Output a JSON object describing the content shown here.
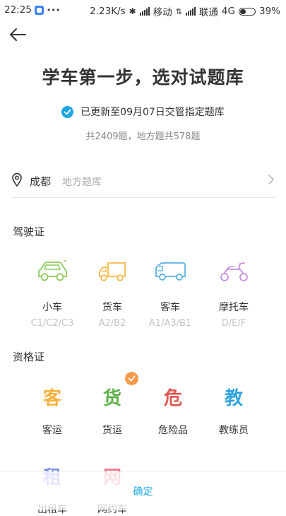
{
  "status_bar": {
    "time": "22:25",
    "dots": "•••",
    "speed": "2.23K/s",
    "carrier1": "移动",
    "carrier2": "联通",
    "network": "4G",
    "battery": "39%"
  },
  "header": {
    "title": "学车第一步，选对试题库",
    "updated": "已更新至09月07日交管指定题库",
    "counts": "共2409题，地方题共578题"
  },
  "location": {
    "city": "成都",
    "placeholder": "地方题库"
  },
  "license": {
    "heading": "驾驶证",
    "items": [
      {
        "label": "小车",
        "sub": "C1/C2/C3",
        "icon": "car-icon",
        "color": "#8ccc5a"
      },
      {
        "label": "货车",
        "sub": "A2/B2",
        "icon": "truck-icon",
        "color": "#f5b94a"
      },
      {
        "label": "客车",
        "sub": "A1/A3/B1",
        "icon": "bus-icon",
        "color": "#5ab0e6"
      },
      {
        "label": "摩托车",
        "sub": "D/E/F",
        "icon": "motorcycle-icon",
        "color": "#c48fe0"
      }
    ]
  },
  "qualification": {
    "heading": "资格证",
    "items": [
      {
        "glyph": "客",
        "label": "客运",
        "color": "#f5b23e",
        "selected": false
      },
      {
        "glyph": "货",
        "label": "货运",
        "color": "#5cb048",
        "selected": true
      },
      {
        "glyph": "危",
        "label": "危险品",
        "color": "#e0574f",
        "selected": false
      },
      {
        "glyph": "教",
        "label": "教练员",
        "color": "#2ea3e0",
        "selected": false
      },
      {
        "glyph": "租",
        "label": "出租车",
        "color": "#7f8fe8",
        "selected": false
      },
      {
        "glyph": "网",
        "label": "网约车",
        "color": "#f07a8a",
        "selected": false
      }
    ]
  },
  "footer": {
    "confirm": "确定"
  },
  "colors": {
    "accent": "#1ba7e0",
    "selected_badge": "#f59a4a"
  }
}
